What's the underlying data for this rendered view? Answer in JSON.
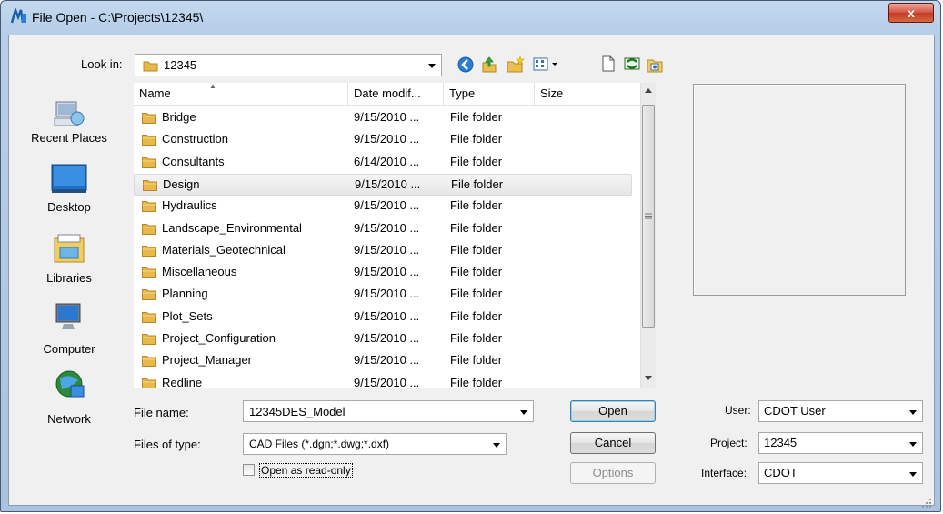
{
  "window": {
    "title": "File Open - C:\\Projects\\12345\\",
    "close_label": "x"
  },
  "look_in": {
    "label": "Look in:",
    "value": "12345"
  },
  "toolbar_icons": [
    "back-icon",
    "up-folder-icon",
    "new-folder-icon",
    "view-menu-icon",
    "new-file-icon",
    "refresh-icon",
    "special-folder-icon"
  ],
  "places": [
    {
      "label": "Recent Places",
      "icon": "recent-places-icon"
    },
    {
      "label": "Desktop",
      "icon": "desktop-icon"
    },
    {
      "label": "Libraries",
      "icon": "libraries-icon"
    },
    {
      "label": "Computer",
      "icon": "computer-icon"
    },
    {
      "label": "Network",
      "icon": "network-icon"
    }
  ],
  "file_list": {
    "columns": [
      "Name",
      "Date modif...",
      "Type",
      "Size"
    ],
    "sort_indicator": "▲",
    "selected_index": 3,
    "rows": [
      {
        "name": "Bridge",
        "date": "9/15/2010 ...",
        "type": "File folder",
        "size": ""
      },
      {
        "name": "Construction",
        "date": "9/15/2010 ...",
        "type": "File folder",
        "size": ""
      },
      {
        "name": "Consultants",
        "date": "6/14/2010 ...",
        "type": "File folder",
        "size": ""
      },
      {
        "name": "Design",
        "date": "9/15/2010 ...",
        "type": "File folder",
        "size": ""
      },
      {
        "name": "Hydraulics",
        "date": "9/15/2010 ...",
        "type": "File folder",
        "size": ""
      },
      {
        "name": "Landscape_Environmental",
        "date": "9/15/2010 ...",
        "type": "File folder",
        "size": ""
      },
      {
        "name": "Materials_Geotechnical",
        "date": "9/15/2010 ...",
        "type": "File folder",
        "size": ""
      },
      {
        "name": "Miscellaneous",
        "date": "9/15/2010 ...",
        "type": "File folder",
        "size": ""
      },
      {
        "name": "Planning",
        "date": "9/15/2010 ...",
        "type": "File folder",
        "size": ""
      },
      {
        "name": "Plot_Sets",
        "date": "9/15/2010 ...",
        "type": "File folder",
        "size": ""
      },
      {
        "name": "Project_Configuration",
        "date": "9/15/2010 ...",
        "type": "File folder",
        "size": ""
      },
      {
        "name": "Project_Manager",
        "date": "9/15/2010 ...",
        "type": "File folder",
        "size": ""
      },
      {
        "name": "Redline",
        "date": "9/15/2010 ...",
        "type": "File folder",
        "size": ""
      }
    ]
  },
  "file_name": {
    "label": "File name:",
    "value": "12345DES_Model"
  },
  "file_type": {
    "label": "Files of type:",
    "value": "CAD Files (*.dgn;*.dwg;*.dxf)"
  },
  "read_only": {
    "label": "Open as read-only",
    "checked": false
  },
  "buttons": {
    "open": "Open",
    "cancel": "Cancel",
    "options": "Options"
  },
  "workspace": {
    "user": {
      "label": "User:",
      "value": "CDOT User"
    },
    "project": {
      "label": "Project:",
      "value": "12345"
    },
    "interface": {
      "label": "Interface:",
      "value": "CDOT"
    }
  },
  "colors": {
    "title_bar": "#b9d1ea",
    "close_button": "#c7442b",
    "selection": "#e8e8e8",
    "folder": "#e8b84a"
  }
}
